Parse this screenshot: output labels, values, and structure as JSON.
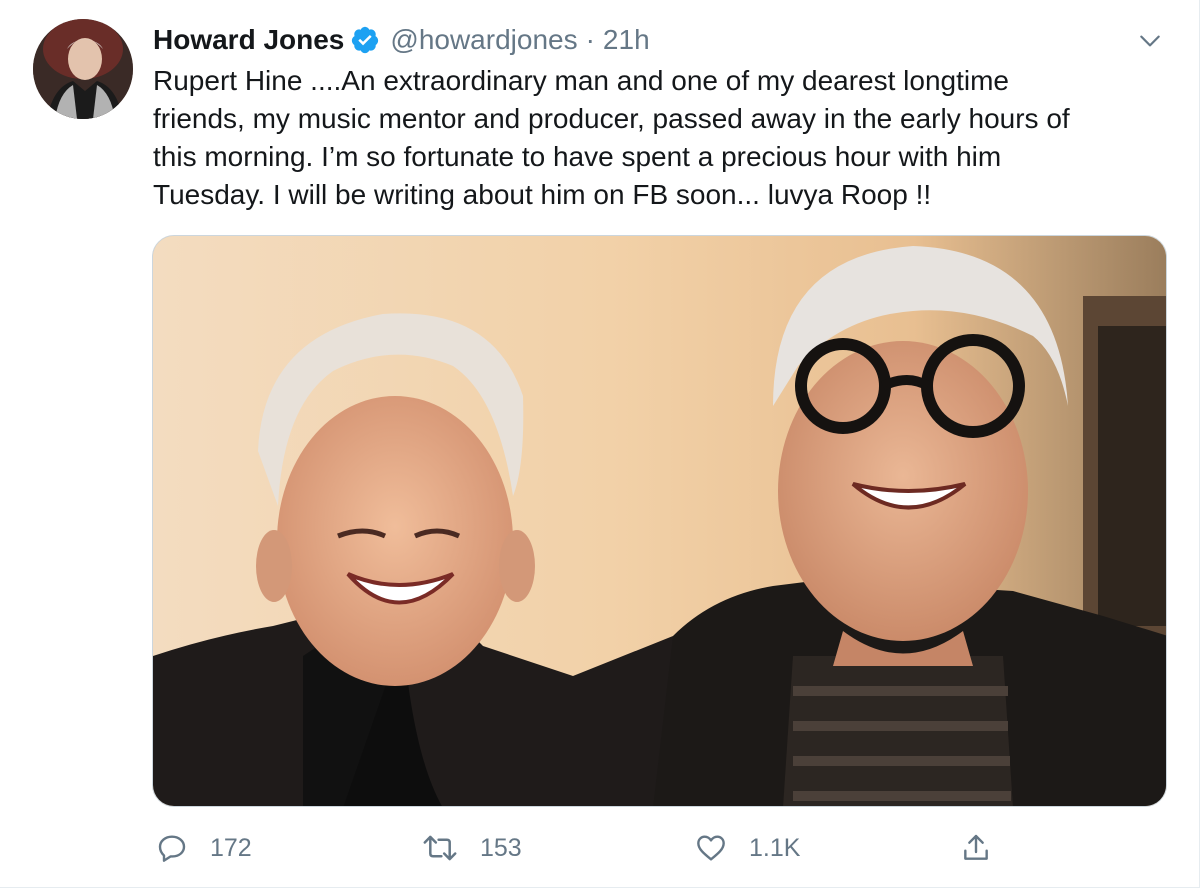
{
  "tweet": {
    "author": {
      "display_name": "Howard Jones",
      "handle": "@howardjones",
      "verified": true
    },
    "separator": "·",
    "time": "21h",
    "text": "Rupert Hine ....An extraordinary man and one of my dearest longtime\nfriends, my music mentor and producer, passed away in the early hours of\nthis morning. I’m so fortunate to have spent a precious hour with him\nTuesday. I will be writing about him on FB soon... luvya Roop !!",
    "actions": {
      "reply_count": "172",
      "retweet_count": "153",
      "like_count": "1.1K"
    }
  },
  "icons": {
    "verified": "verified-badge-icon",
    "caret": "chevron-down-icon",
    "reply": "reply-icon",
    "retweet": "retweet-icon",
    "like": "heart-icon",
    "share": "share-icon"
  },
  "colors": {
    "text_primary": "#14171a",
    "text_secondary": "#657786",
    "verified_blue": "#1da1f2",
    "border": "#e6ecf0"
  }
}
